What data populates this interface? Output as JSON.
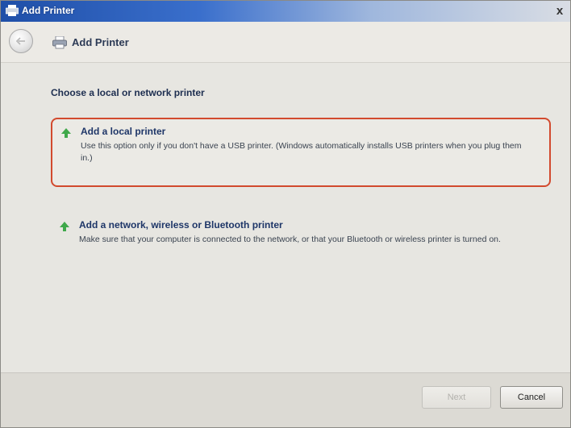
{
  "window": {
    "title": "Add Printer",
    "close_glyph": "x"
  },
  "nav": {
    "title": "Add Printer",
    "back_icon": "back-arrow-icon",
    "printer_icon": "printer-icon"
  },
  "main": {
    "heading": "Choose a local or network printer",
    "options": [
      {
        "title": "Add a local printer",
        "description": "Use this option only if you don't have a USB printer. (Windows automatically installs USB printers when you plug them in.)",
        "icon": "green-arrow-icon",
        "highlighted": true,
        "highlight_color": "#d24a2e"
      },
      {
        "title": "Add a network, wireless or Bluetooth printer",
        "description": "Make sure that your computer is connected to the network, or that your Bluetooth or wireless printer is turned on.",
        "icon": "green-arrow-icon",
        "highlighted": false
      }
    ]
  },
  "footer": {
    "next_label": "Next",
    "next_enabled": false,
    "cancel_label": "Cancel"
  }
}
